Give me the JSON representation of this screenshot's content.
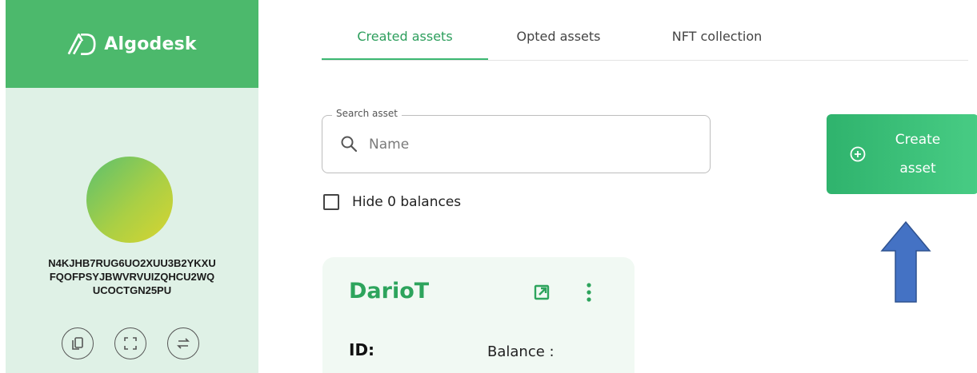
{
  "sidebar": {
    "brand_name": "Algodesk",
    "address_lines": [
      "N4KJHB7RUG6UO2XUU3B2YKXU",
      "FQOFPSYJBWVRVUIZQHCU2WQ",
      "UCOCTGN25PU"
    ],
    "actions": [
      {
        "icon": "copy-icon"
      },
      {
        "icon": "qr-scan-icon"
      },
      {
        "icon": "transfer-icon"
      }
    ]
  },
  "tabs": [
    {
      "label": "Created assets",
      "active": true
    },
    {
      "label": "Opted assets",
      "active": false
    },
    {
      "label": "NFT collection",
      "active": false
    }
  ],
  "search": {
    "legend": "Search asset",
    "placeholder": "Name",
    "value": ""
  },
  "filter": {
    "hide_zero_label": "Hide 0 balances",
    "checked": false
  },
  "create_button": {
    "label": "Create asset"
  },
  "asset_card": {
    "name": "DarioT",
    "id_label": "ID:",
    "balance_label": "Balance :"
  },
  "colors": {
    "brand_green": "#4cb96c",
    "sidebar_bg": "#dff1e6",
    "accent_text": "#2da45c",
    "arrow_fill": "#4472c4"
  }
}
